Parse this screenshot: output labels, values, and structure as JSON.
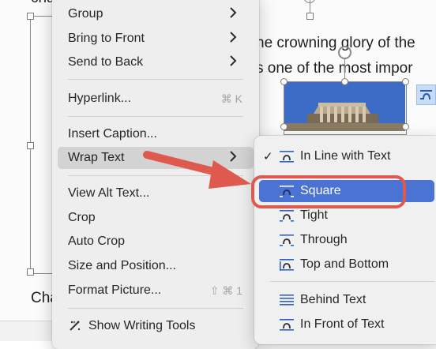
{
  "document": {
    "line_top_left": "cha",
    "line_1": "he crowning glory of the",
    "line_2": "s one of the most impor",
    "line_bottom_left": "Cha"
  },
  "context_menu": {
    "items": [
      {
        "label": "Group",
        "submenu": true
      },
      {
        "label": "Bring to Front",
        "submenu": true
      },
      {
        "label": "Send to Back",
        "submenu": true
      },
      {
        "label": "Hyperlink...",
        "shortcut": "⌘ K"
      },
      {
        "label": "Insert Caption..."
      },
      {
        "label": "Wrap Text",
        "submenu": true
      },
      {
        "label": "View Alt Text..."
      },
      {
        "label": "Crop"
      },
      {
        "label": "Auto Crop"
      },
      {
        "label": "Size and Position..."
      },
      {
        "label": "Format Picture...",
        "shortcut": "⇧ ⌘ 1"
      },
      {
        "label": "Show Writing Tools",
        "icon": "writing-tools-icon"
      }
    ]
  },
  "wrap_text_submenu": {
    "items": [
      {
        "label": "In Line with Text",
        "checked": true,
        "icon": "wrap-inline-icon"
      },
      {
        "label": "Square",
        "selected": true,
        "icon": "wrap-square-icon"
      },
      {
        "label": "Tight",
        "icon": "wrap-tight-icon"
      },
      {
        "label": "Through",
        "icon": "wrap-through-icon"
      },
      {
        "label": "Top and Bottom",
        "icon": "wrap-top-bottom-icon"
      },
      {
        "label": "Behind Text",
        "icon": "wrap-behind-icon"
      },
      {
        "label": "In Front of Text",
        "icon": "wrap-front-icon"
      }
    ],
    "check_mark": "✓"
  },
  "colors": {
    "highlight_blue": "#4a73d3",
    "annotation_red": "#e0594e",
    "hover_gray": "#d3d3d3"
  }
}
